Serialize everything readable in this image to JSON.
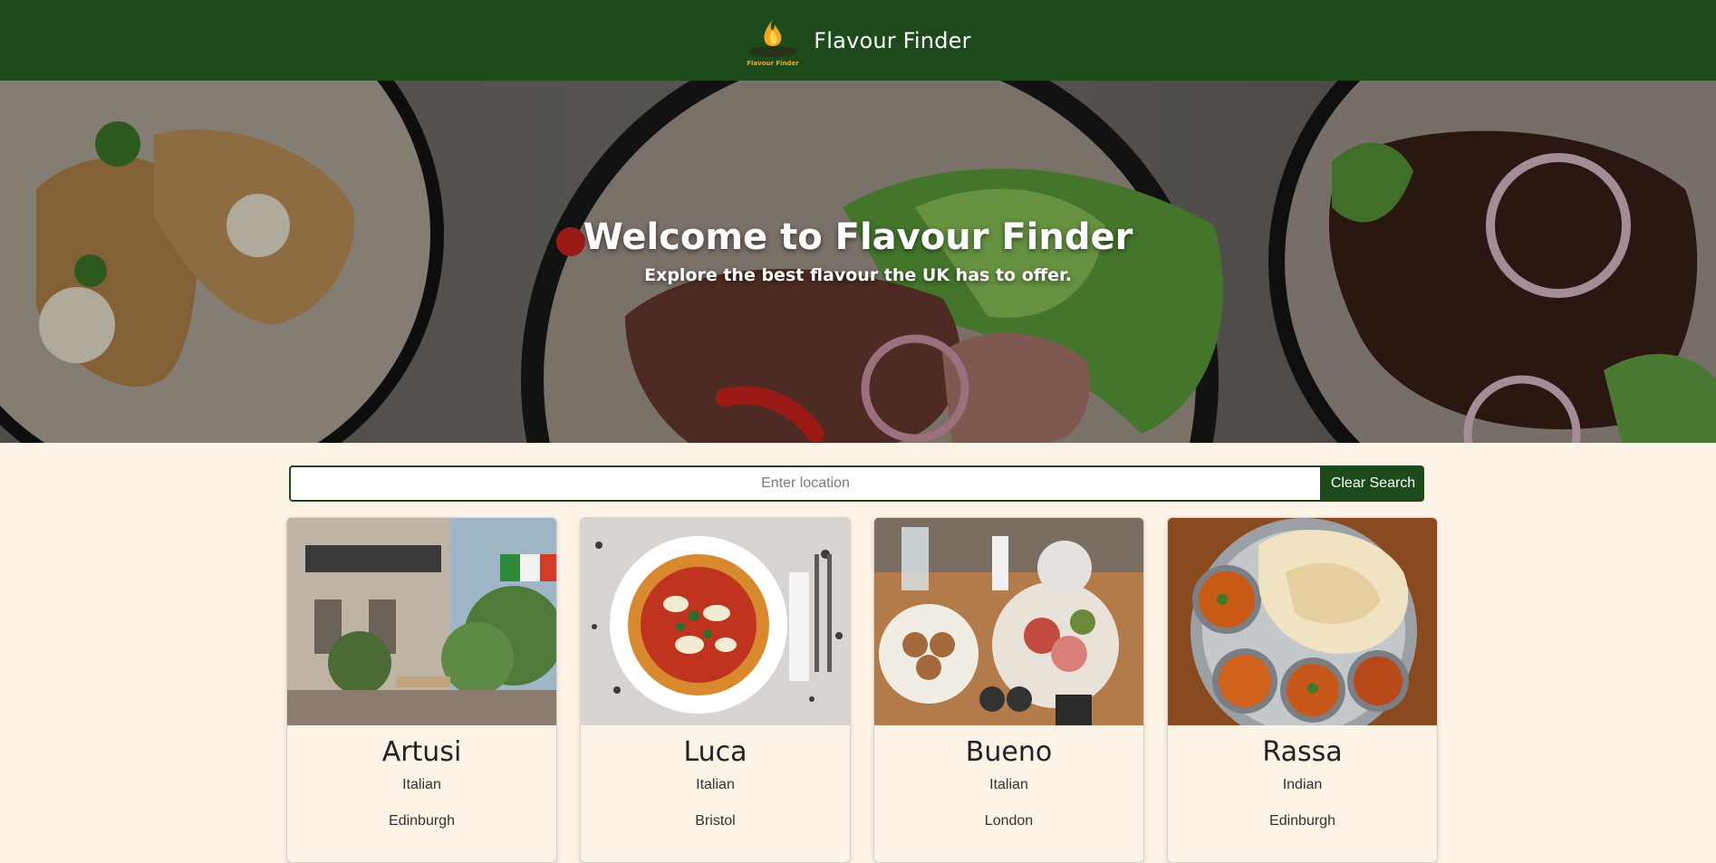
{
  "header": {
    "logo_text": "Flavour Finder",
    "title": "Flavour Finder"
  },
  "hero": {
    "title": "Welcome to Flavour Finder",
    "subtitle": "Explore the best flavour the UK has to offer."
  },
  "search": {
    "placeholder": "Enter location",
    "value": "",
    "clear_label": "Clear Search"
  },
  "restaurants": [
    {
      "name": "Artusi",
      "cuisine": "Italian",
      "city": "Edinburgh"
    },
    {
      "name": "Luca",
      "cuisine": "Italian",
      "city": "Bristol"
    },
    {
      "name": "Bueno",
      "cuisine": "Italian",
      "city": "London"
    },
    {
      "name": "Rassa",
      "cuisine": "Indian",
      "city": "Edinburgh"
    }
  ],
  "colors": {
    "header_bg": "#1d4a1b",
    "page_bg": "#fdf3e7",
    "accent": "#1d4a1b"
  }
}
